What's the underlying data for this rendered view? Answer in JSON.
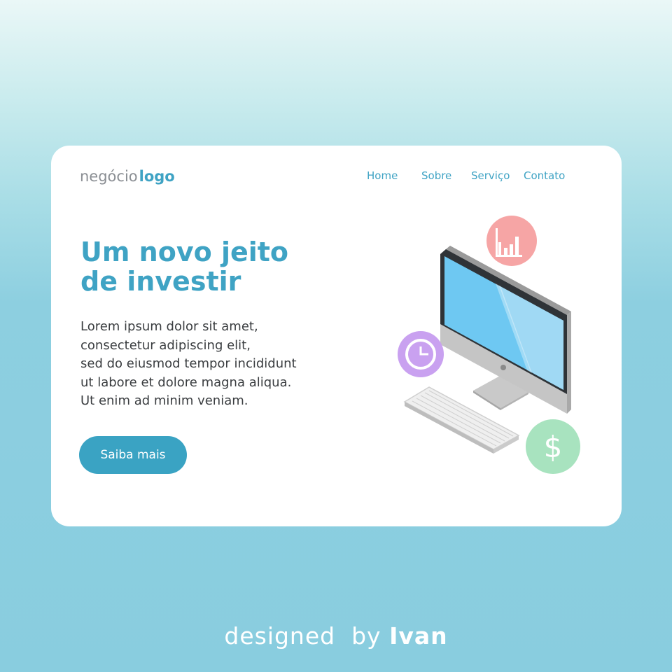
{
  "brand": {
    "word": "negócio",
    "strong": "logo"
  },
  "nav": {
    "items": [
      "Home",
      "Sobre",
      "Serviço",
      "Contato"
    ]
  },
  "hero": {
    "title_lines": [
      "Um novo jeito",
      "de investir"
    ],
    "text_lines": [
      "Lorem ipsum dolor sit amet,",
      "consectetur adipiscing elit,",
      "sed do eiusmod tempor incididunt",
      "ut labore et dolore magna aliqua.",
      "Ut enim ad minim veniam."
    ],
    "cta_label": "Saiba mais"
  },
  "illustration": {
    "icons": [
      "bar-chart-icon",
      "pie-chart-icon",
      "dollar-icon"
    ],
    "dollar_symbol": "$",
    "colors": {
      "chart_badge": "#f6a5a5",
      "pie_badge": "#c9a1f0",
      "dollar_badge": "#a8e3bf",
      "screen": "#6ec8f2",
      "monitor_frame": "#c7c7c7"
    }
  },
  "credit": {
    "prefix": "designed  by",
    "author": "Ivan"
  },
  "colors": {
    "accent": "#3fa3c4",
    "card_bg": "#ffffff",
    "text": "#3a3d40",
    "logo_gray": "#8a8e93"
  }
}
